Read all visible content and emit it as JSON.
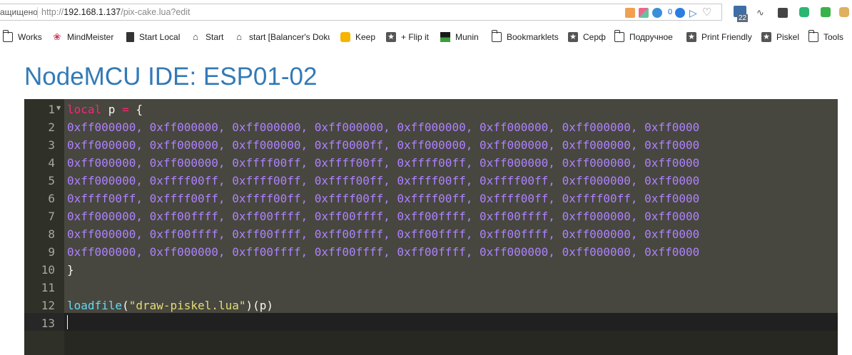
{
  "browser": {
    "security_label": "ащищено",
    "url_prefix": "http://",
    "url_host": "192.168.1.137",
    "url_path": "/pix-cake.lua?edit",
    "extension_counter": "0",
    "tab_badge_count": "22"
  },
  "bookmarks": [
    {
      "label": "Works",
      "icon": "folder-icon"
    },
    {
      "label": "MindMeister",
      "icon": "mindmeister-icon"
    },
    {
      "label": "Start Local",
      "icon": "document-icon"
    },
    {
      "label": "Start",
      "icon": "home-icon"
    },
    {
      "label": "start [Balancer's Doku",
      "icon": "home-icon"
    },
    {
      "label": "Keep",
      "icon": "keep-icon"
    },
    {
      "label": "+ Flip it",
      "icon": "star-icon"
    },
    {
      "label": "Munin",
      "icon": "munin-icon"
    },
    {
      "label": "Bookmarklets",
      "icon": "folder-icon"
    },
    {
      "label": "Серф",
      "icon": "star-icon"
    },
    {
      "label": "Подручное",
      "icon": "folder-icon"
    },
    {
      "label": "Print Friendly",
      "icon": "star-icon"
    },
    {
      "label": "Piskel",
      "icon": "star-icon"
    },
    {
      "label": "Tools",
      "icon": "folder-icon"
    }
  ],
  "page": {
    "title": "NodeMCU IDE: ESP01-02"
  },
  "editor": {
    "line_numbers": [
      "1",
      "2",
      "3",
      "4",
      "5",
      "6",
      "7",
      "8",
      "9",
      "10",
      "11",
      "12",
      "13"
    ],
    "line1": {
      "kw": "local",
      "p1": " p ",
      "kw2": "=",
      "p2": " {"
    },
    "array_lines": [
      "0xff000000, 0xff000000, 0xff000000, 0xff000000, 0xff000000, 0xff000000, 0xff000000, 0xff0000",
      "0xff000000, 0xff000000, 0xff000000, 0xff0000ff, 0xff000000, 0xff000000, 0xff000000, 0xff0000",
      "0xff000000, 0xff000000, 0xffff00ff, 0xffff00ff, 0xffff00ff, 0xff000000, 0xff000000, 0xff0000",
      "0xff000000, 0xffff00ff, 0xffff00ff, 0xffff00ff, 0xffff00ff, 0xffff00ff, 0xff000000, 0xff0000",
      "0xffff00ff, 0xffff00ff, 0xffff00ff, 0xffff00ff, 0xffff00ff, 0xffff00ff, 0xffff00ff, 0xff0000",
      "0xff000000, 0xff00ffff, 0xff00ffff, 0xff00ffff, 0xff00ffff, 0xff00ffff, 0xff000000, 0xff0000",
      "0xff000000, 0xff00ffff, 0xff00ffff, 0xff00ffff, 0xff00ffff, 0xff00ffff, 0xff000000, 0xff0000",
      "0xff000000, 0xff000000, 0xff00ffff, 0xff00ffff, 0xff00ffff, 0xff000000, 0xff000000, 0xff0000"
    ],
    "line10": "}",
    "line12": {
      "fn": "loadfile",
      "open": "(",
      "str": "\"draw-piskel.lua\"",
      "close": ")(p)"
    }
  },
  "colors": {
    "title": "#337ab7",
    "editor_bg": "#272822",
    "keyword": "#f92672",
    "number": "#ae81ff",
    "function": "#66d9ef",
    "string": "#e6db74"
  }
}
